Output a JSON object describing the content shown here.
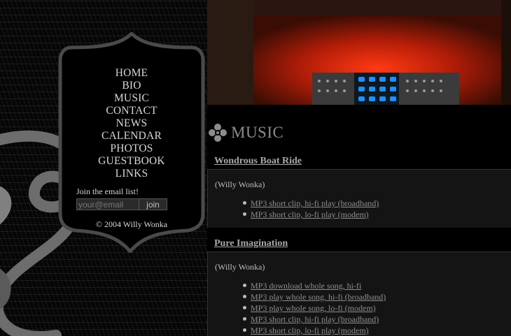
{
  "nav": {
    "items": [
      "HOME",
      "BIO",
      "MUSIC",
      "CONTACT",
      "NEWS",
      "CALENDAR",
      "PHOTOS",
      "GUESTBOOK",
      "LINKS"
    ]
  },
  "email": {
    "label": "Join the email list!",
    "placeholder": "your@email",
    "join_label": "join"
  },
  "footer": {
    "copyright": "© 2004 Willy Wonka"
  },
  "section": {
    "title": "MUSIC",
    "icon": "flower-ornament-icon"
  },
  "songs": [
    {
      "title": "Wondrous Boat Ride",
      "credit": "(Willy Wonka)",
      "links": [
        "MP3 short clip, hi-fi play (broadband)",
        "MP3 short clip, lo-fi play (modem)"
      ]
    },
    {
      "title": "Pure Imagination",
      "credit": "(Willy Wonka)",
      "links": [
        "MP3 download whole song, hi-fi",
        "MP3 play whole song, hi-fi (broadband)",
        "MP3 play whole song, lo-fi (modem)",
        "MP3 short clip, hi-fi play (broadband)",
        "MP3 short clip, lo-fi play (modem)"
      ]
    }
  ],
  "colors": {
    "accent_red": "#e0260e",
    "led_blue": "#1e90ff",
    "link": "#8d8d8d"
  }
}
